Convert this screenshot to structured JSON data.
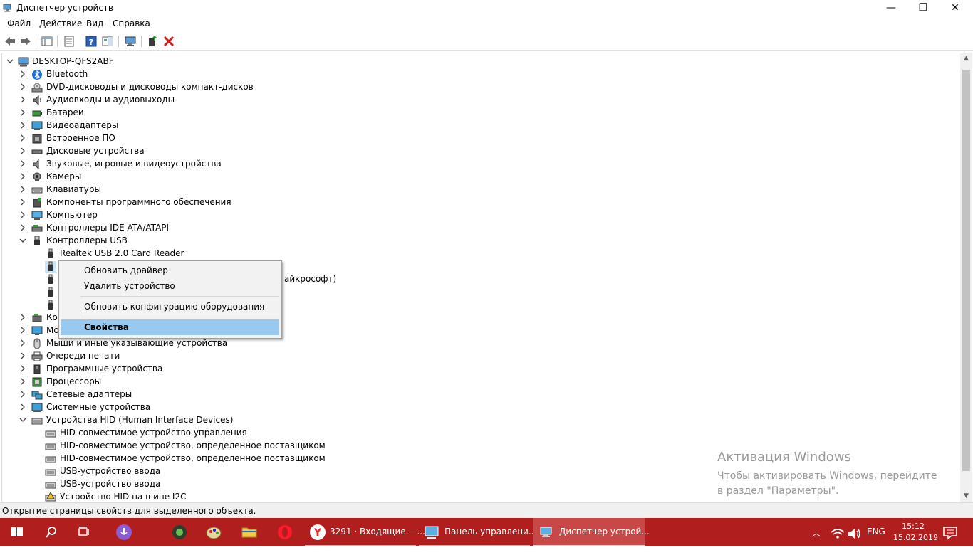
{
  "window": {
    "title": "Диспетчер устройств",
    "minimize": "—",
    "maximize": "❐",
    "close": "✕"
  },
  "menu": [
    "Файл",
    "Действие",
    "Вид",
    "Справка"
  ],
  "tree": {
    "root": "DESKTOP-QFS2ABF",
    "categories": [
      "Bluetooth",
      "DVD-дисководы и дисководы компакт-дисков",
      "Аудиовходы и аудиовыходы",
      "Батареи",
      "Видеоадаптеры",
      "Встроенное ПО",
      "Дисковые устройства",
      "Звуковые, игровые и видеоустройства",
      "Камеры",
      "Клавиатуры",
      "Компоненты программного обеспечения",
      "Компьютер",
      "Контроллеры IDE ATA/ATAPI",
      "Контроллеры USB"
    ],
    "usb_children": [
      "Realtek USB 2.0 Card Reader",
      "",
      "айкрософт)",
      "",
      ""
    ],
    "categories_after": [
      "Кон",
      "Мо",
      "Мыши и иные указывающие устройства",
      "Очереди печати",
      "Программные устройства",
      "Процессоры",
      "Сетевые адаптеры",
      "Системные устройства",
      "Устройства HID (Human Interface Devices)"
    ],
    "hid_children": [
      "HID-совместимое устройство управления",
      "HID-совместимое устройство, определенное поставщиком",
      "HID-совместимое устройство, определенное поставщиком",
      "USB-устройство ввода",
      "USB-устройство ввода",
      "Устройство HID на шине I2C"
    ]
  },
  "context_menu": {
    "items": [
      "Обновить драйвер",
      "Удалить устройство",
      "Обновить конфигурацию оборудования",
      "Свойства"
    ]
  },
  "status": "Открытие страницы свойств для выделенного объекта.",
  "watermark": {
    "line1": "Активация Windows",
    "line2": "Чтобы активировать Windows, перейдите в раздел \"Параметры\"."
  },
  "taskbar": {
    "items": [
      "3291 · Входящие —...",
      "Панель управлени...",
      "Диспетчер устрой..."
    ],
    "lang": "ENG",
    "time": "15:12",
    "date": "15.02.2019"
  },
  "colors": {
    "taskbar": "#b01e1e",
    "selection": "#99c9ef"
  }
}
